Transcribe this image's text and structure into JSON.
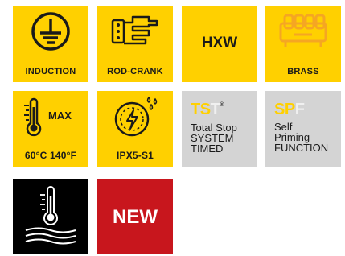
{
  "tiles": {
    "induction": {
      "label": "INDUCTION",
      "icon": "ground-symbol-icon"
    },
    "rod_crank": {
      "label": "ROD-CRANK",
      "icon": "crankshaft-icon"
    },
    "hxw": {
      "label": "HXW"
    },
    "brass": {
      "label": "BRASS",
      "icon": "brass-manifold-icon"
    },
    "max_temp": {
      "word": "MAX",
      "label": "60°C 140°F",
      "icon": "thermometer-icon"
    },
    "ipx": {
      "label": "IPX5-S1",
      "icon": "water-protection-icon"
    },
    "tst": {
      "brand_a": "TS",
      "brand_b": "T",
      "mark": "®",
      "lines": [
        "Total Stop",
        "SYSTEM",
        "TIMED"
      ]
    },
    "spf": {
      "brand_a": "SP",
      "brand_b": "F",
      "lines": [
        "Self",
        "Priming",
        "FUNCTION"
      ]
    },
    "hot_water": {
      "icon": "thermometer-heat-icon"
    },
    "new": {
      "label": "NEW"
    }
  },
  "colors": {
    "yellow": "#ffd000",
    "grey": "#d4d4d4",
    "orange": "#f5a623",
    "red": "#c8161d",
    "black": "#000000"
  }
}
